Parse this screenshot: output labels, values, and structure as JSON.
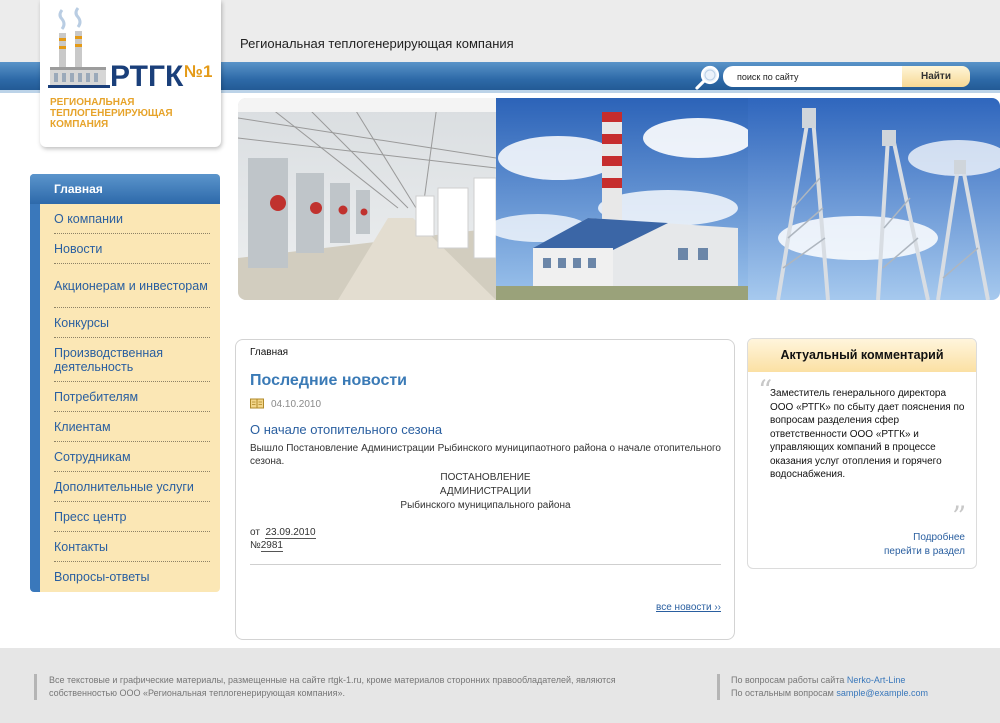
{
  "header": {
    "tagline": "Региональная теплогенерирующая компания",
    "logo": {
      "wordmark": "РТГК",
      "number": "№1",
      "subtitle": "РЕГИОНАЛЬНАЯ ТЕПЛОГЕНЕРИРУЮЩАЯ КОМПАНИЯ"
    },
    "search": {
      "placeholder": "поиск по сайту",
      "value": "поиск по сайту",
      "button_label": "Найти"
    }
  },
  "colors": {
    "nav_bg": "#fbe7b5",
    "accent_blue": "#2e6aa8",
    "link_blue": "#2a5fa0",
    "logo_orange": "#e49a17"
  },
  "nav": {
    "active": "Главная",
    "items": [
      {
        "label": "О компании"
      },
      {
        "label": "Новости"
      },
      {
        "label": "Акционерам и инвесторам"
      },
      {
        "label": "Конкурсы"
      },
      {
        "label": "Производственная деятельность"
      },
      {
        "label": "Потребителям"
      },
      {
        "label": "Клиентам"
      },
      {
        "label": "Сотрудникам"
      },
      {
        "label": "Дополнительные услуги"
      },
      {
        "label": "Пресс центр"
      },
      {
        "label": "Контакты"
      },
      {
        "label": "Вопросы-ответы"
      }
    ]
  },
  "main": {
    "breadcrumb": "Главная",
    "section_title": "Последние новости",
    "news": {
      "date": "04.10.2010",
      "title": "О начале отопительного сезона",
      "body": "Вышло Постановление Администрации Рыбинского муниципаотного района о начале отопительного сезона.",
      "center_lines": [
        "ПОСТАНОВЛЕНИЕ",
        "АДМИНИСТРАЦИИ",
        "Рыбинского муниципального района"
      ],
      "ref_prefix": "от",
      "ref_date": "23.09.2010",
      "ref_no_prefix": "№",
      "ref_no": "2981"
    },
    "all_news_link": "все новости ››"
  },
  "comment": {
    "title": "Актуальный комментарий",
    "text": "Заместитель генерального директора ООО «РТГК» по сбыту дает пояснения по вопросам разделения сфер ответственности ООО «РТГК» и управляющих компаний в процессе оказания услуг отопления и горячего водоснабжения.",
    "more_label": "Подробнее",
    "section_label": "перейти в раздел"
  },
  "footer": {
    "copyright": "Все текстовые и графические материалы, размещенные на сайте rtgk-1.ru, кроме материалов сторонних правообладателей, являются собственностью ООО «Региональная теплогенерирующая компания».",
    "site_q_prefix": "По вопросам работы сайта",
    "site_q_link": "Nerko-Art-Line",
    "other_q_prefix": "По остальным вопросам",
    "other_q_link": "sample@example.com"
  }
}
